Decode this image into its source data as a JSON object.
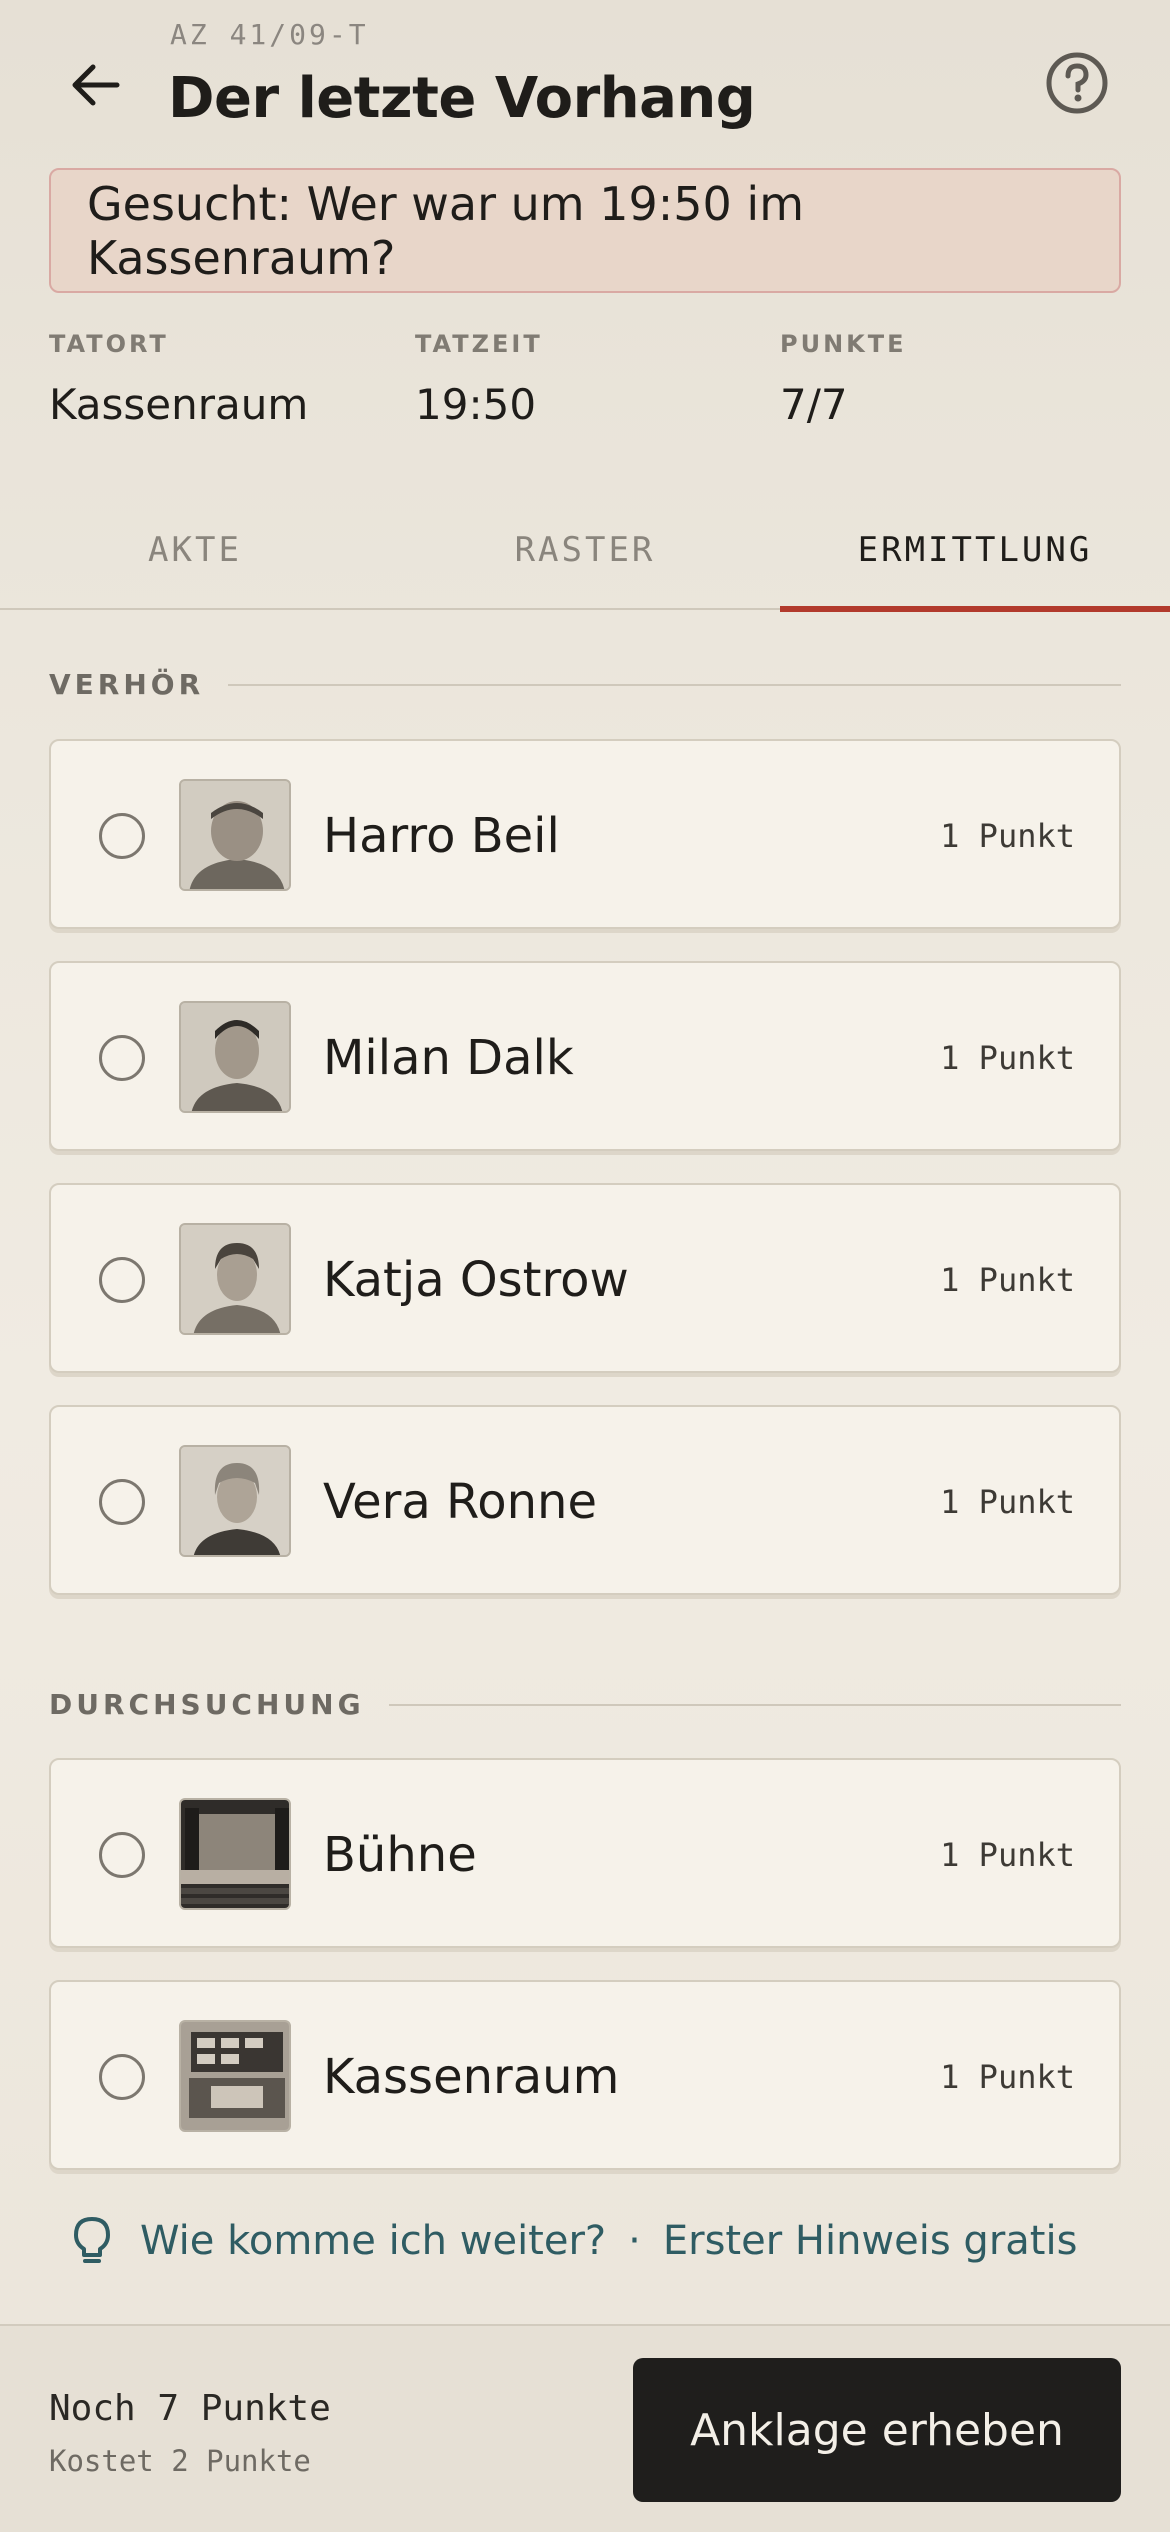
{
  "header": {
    "case_id": "AZ 41/09-T",
    "title": "Der letzte Vorhang"
  },
  "wanted": "Gesucht: Wer war um 19:50 im Kassenraum?",
  "stats": [
    {
      "label": "TATORT",
      "value": "Kassenraum"
    },
    {
      "label": "TATZEIT",
      "value": "19:50"
    },
    {
      "label": "PUNKTE",
      "value": "7/7"
    }
  ],
  "tabs": [
    {
      "label": "AKTE",
      "active": false
    },
    {
      "label": "RASTER",
      "active": false
    },
    {
      "label": "ERMITTLUNG",
      "active": true
    }
  ],
  "sections": {
    "interrogation": {
      "title": "VERHÖR",
      "items": [
        {
          "name": "Harro Beil",
          "cost": "1 Punkt",
          "selected": false
        },
        {
          "name": "Milan Dalk",
          "cost": "1 Punkt",
          "selected": false
        },
        {
          "name": "Katja Ostrow",
          "cost": "1 Punkt",
          "selected": false
        },
        {
          "name": "Vera Ronne",
          "cost": "1 Punkt",
          "selected": false
        }
      ]
    },
    "search": {
      "title": "DURCHSUCHUNG",
      "items": [
        {
          "name": "Bühne",
          "cost": "1 Punkt",
          "selected": false
        },
        {
          "name": "Kassenraum",
          "cost": "1 Punkt",
          "selected": false
        }
      ]
    }
  },
  "hint": {
    "question": "Wie komme ich weiter?",
    "separator": "·",
    "offer": "Erster Hinweis gratis"
  },
  "footer": {
    "remaining": "Noch 7 Punkte",
    "cost_note": "Kostet 2 Punkte",
    "accuse_label": "Anklage erheben"
  },
  "colors": {
    "accent": "#b23a2c",
    "hint": "#2f5c63",
    "button": "#1f1e1c"
  },
  "icons": [
    "back-arrow-icon",
    "help-icon",
    "lightbulb-icon"
  ]
}
